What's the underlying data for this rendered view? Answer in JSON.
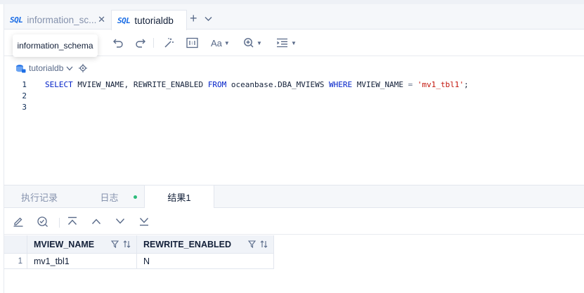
{
  "tabs": [
    {
      "badge": "SQL",
      "label": "information_sc...",
      "close": "✕"
    },
    {
      "badge": "SQL",
      "label": "tutorialdb"
    }
  ],
  "tab_add": "+",
  "tooltip": "information_schema",
  "toolbar": {
    "font_label": "Aa"
  },
  "database": {
    "name": "tutorialdb"
  },
  "editor": {
    "line_numbers": [
      "1",
      "2",
      "3"
    ],
    "tokens": {
      "select": "SELECT",
      "col1": " MVIEW_NAME, ",
      "col2": "REWRITE_ENABLED ",
      "from": "FROM",
      "table": " oceanbase.DBA_MVIEWS ",
      "where": "WHERE",
      "col3": " MVIEW_NAME ",
      "eq": "=",
      "sp": " ",
      "value": "'mv1_tbl1'",
      "semi": ";"
    }
  },
  "bottom_tabs": [
    {
      "label": "执行记录"
    },
    {
      "label": "日志"
    },
    {
      "label": "结果1"
    }
  ],
  "results": {
    "columns": [
      "MVIEW_NAME",
      "REWRITE_ENABLED"
    ],
    "rows": [
      {
        "index": "1",
        "cells": [
          "mv1_tbl1",
          "N"
        ]
      }
    ]
  },
  "colors": {
    "accent": "#1d6ee5",
    "keyword": "#0020c8",
    "string": "#c4170e",
    "status_dot": "#2cbb7a"
  }
}
